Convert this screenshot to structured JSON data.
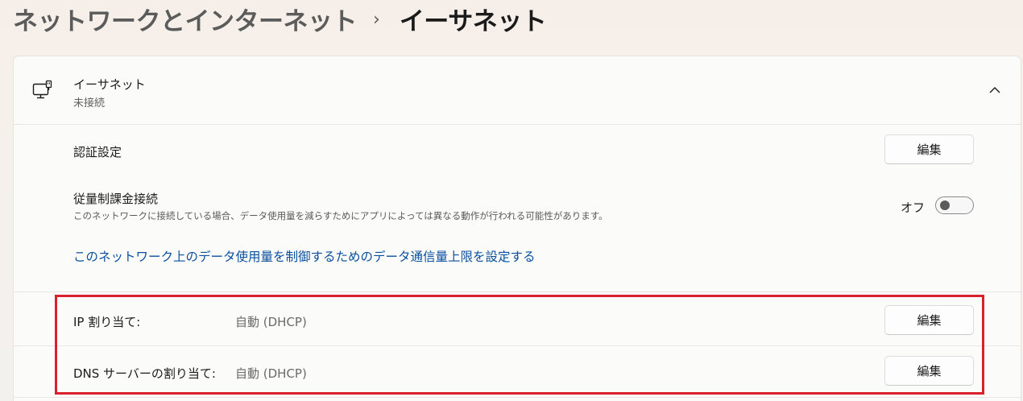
{
  "breadcrumb": {
    "parent": "ネットワークとインターネット",
    "separator": "›",
    "current": "イーサネット"
  },
  "ethernet": {
    "title": "イーサネット",
    "status": "未接続",
    "icon": "ethernet-icon",
    "expand_icon": "chevron-up-icon"
  },
  "auth_settings": {
    "label": "認証設定",
    "button": "編集"
  },
  "metered": {
    "label": "従量制課金接続",
    "description": "このネットワークに接続している場合、データ使用量を減らすためにアプリによっては異なる動作が行われる可能性があります。",
    "toggle_state": "オフ",
    "toggle_on": false,
    "link": "このネットワーク上のデータ使用量を制御するためのデータ通信量上限を設定する"
  },
  "ip_assignment": {
    "label": "IP 割り当て:",
    "value": "自動 (DHCP)",
    "button": "編集"
  },
  "dns_assignment": {
    "label": "DNS サーバーの割り当て:",
    "value": "自動 (DHCP)",
    "button": "編集"
  },
  "colors": {
    "link": "#0a4f9e",
    "highlight": "#d9202c",
    "background": "#f5f0eb"
  }
}
